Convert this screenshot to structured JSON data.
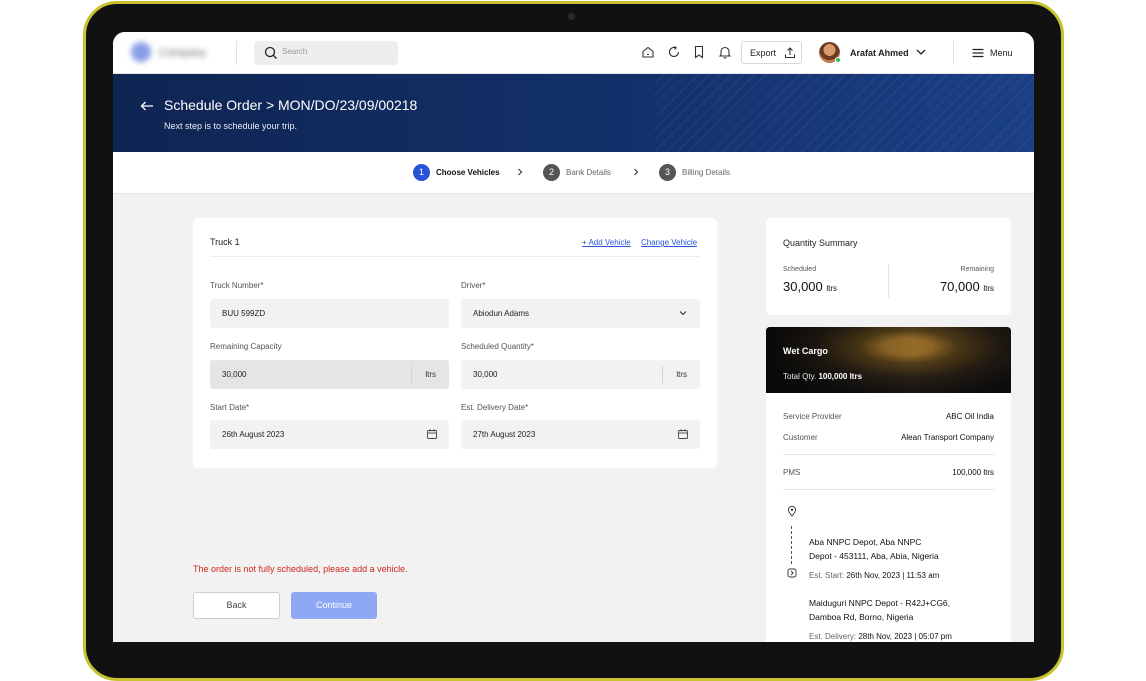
{
  "nav": {
    "search_placeholder": "Search",
    "export_label": "Export",
    "user_name": "Arafat Ahmed",
    "menu_label": "Menu",
    "icons": [
      "home-icon",
      "refresh-icon",
      "bookmark-icon",
      "bell-icon"
    ]
  },
  "banner": {
    "title": "Schedule Order > MON/DO/23/09/00218",
    "subtitle": "Next step is to schedule your trip."
  },
  "steps": [
    {
      "number": "1",
      "label": "Choose Vehicles",
      "active": true
    },
    {
      "number": "2",
      "label": "Bank Details",
      "active": false
    },
    {
      "number": "3",
      "label": "Billing Details",
      "active": false
    }
  ],
  "truck": {
    "title": "Truck 1",
    "add_vehicle": "+ Add Vehicle",
    "change_vehicle": "Change Vehicle",
    "truck_number_label": "Truck Number*",
    "truck_number_value": "BUU 599ZD",
    "driver_label": "Driver*",
    "driver_value": "Abiodun Adams",
    "remaining_capacity_label": "Remaining Capacity",
    "remaining_capacity_value": "30,000",
    "scheduled_quantity_label": "Scheduled Quantity*",
    "scheduled_quantity_value": "30,000",
    "unit": "ltrs",
    "start_date_label": "Start Date*",
    "start_date_value": "26th August 2023",
    "delivery_date_label": "Est. Delivery Date*",
    "delivery_date_value": "27th August 2023"
  },
  "error_message": "The order is not fully scheduled, please add a vehicle.",
  "buttons": {
    "back": "Back",
    "continue": "Continue"
  },
  "summary": {
    "title": "Quantity Summary",
    "scheduled_label": "Scheduled",
    "scheduled_value": "30,000",
    "remaining_label": "Remaining",
    "remaining_value": "70,000",
    "unit": "ltrs"
  },
  "cargo": {
    "title": "Wet Cargo",
    "total_label": "Total Qty.",
    "total_value": "100,000 ltrs"
  },
  "details": {
    "service_provider_label": "Service Provider",
    "service_provider_value": "ABC Oil India",
    "customer_label": "Customer",
    "customer_value": "Alean Transport Company",
    "product_label": "PMS",
    "product_value": "100,000 ltrs",
    "origin_line1": "Aba NNPC Depot, Aba NNPC",
    "origin_line2": "Depot - 453111, Aba, Abia, Nigeria",
    "start_label": "Est. Start:",
    "start_value": "26th Nov, 2023 | 11:53 am",
    "dest_line1": "Maiduguri NNPC Depot - R42J+CG6,",
    "dest_line2": "Damboa Rd, Borno, Nigeria",
    "delivery_label": "Est. Delivery:",
    "delivery_value": "28th Nov, 2023 | 05:07 pm"
  },
  "colors": {
    "accent": "#2855d8",
    "banner": "#13306a",
    "error": "#d0261d",
    "continue_disabled": "#8ea8f4"
  }
}
